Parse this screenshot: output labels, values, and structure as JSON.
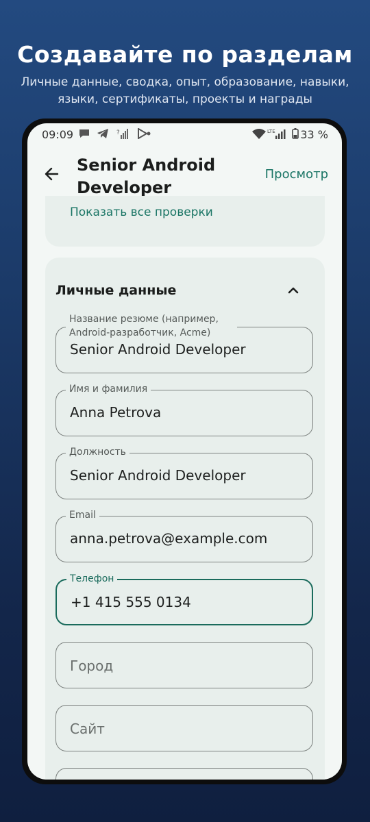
{
  "promo": {
    "title": "Создавайте по разделам",
    "subtitle": "Личные данные, сводка, опыт, образование, навыки, языки, сертификаты, проекты и награды"
  },
  "statusbar": {
    "time": "09:09",
    "battery": "33 %",
    "icons": [
      "chat-bubble-icon",
      "telegram-icon",
      "signal-unknown-icon",
      "cast-icon",
      "wifi-icon",
      "lte-signal-icon",
      "battery-icon"
    ]
  },
  "appbar": {
    "title": "Senior Android Developer",
    "preview_label": "Просмотр",
    "back_icon": "arrow-left-icon"
  },
  "checks": {
    "show_all_label": "Показать все проверки"
  },
  "personal": {
    "section_title": "Личные данные",
    "fields": [
      {
        "label": "Название резюме (например, Android-разработчик, Acme)",
        "value": "Senior Android Developer"
      },
      {
        "label": "Имя и фамилия",
        "value": "Anna Petrova"
      },
      {
        "label": "Должность",
        "value": "Senior Android Developer"
      },
      {
        "label": "Email",
        "value": "anna.petrova@example.com"
      },
      {
        "label": "Телефон",
        "value": "+1 415 555 0134"
      },
      {
        "placeholder": "Город"
      },
      {
        "placeholder": "Сайт"
      }
    ]
  },
  "colors": {
    "accent": "#1a7565",
    "focused_border": "#1a6b5c",
    "card_bg": "#e8efec",
    "screen_bg": "#f3f7f5"
  }
}
